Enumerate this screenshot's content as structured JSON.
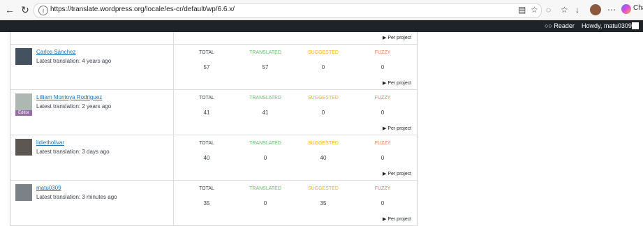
{
  "browser": {
    "url": "https://translate.wordpress.org/locale/es-cr/default/wp/6.6.x/",
    "copilot_label": "Cha",
    "icons": [
      "back-arrow-icon",
      "refresh-icon",
      "site-info-icon",
      "reader-view-icon",
      "star-icon",
      "extension-icon",
      "favorites-icon",
      "download-icon",
      "profile-icon",
      "more-icon",
      "copilot-icon"
    ]
  },
  "wp_bar": {
    "reader_label": "Reader",
    "howdy_label": "Howdy, matu0309"
  },
  "table": {
    "top_per_project": "Per project",
    "column_labels": {
      "total": "TOTAL",
      "translated": "TRANSLATED",
      "suggested": "SUGGESTED",
      "fuzzy": "FUZZY"
    },
    "per_project_label": "Per project",
    "rows": [
      {
        "name": "Carlos Sánchez",
        "latest": "Latest translation: 4 years ago",
        "total": "57",
        "translated": "57",
        "suggested": "0",
        "fuzzy": "0",
        "badge": ""
      },
      {
        "name": "Lilliam Montoya Rodriguez",
        "latest": "Latest translation: 2 years ago",
        "total": "41",
        "translated": "41",
        "suggested": "0",
        "fuzzy": "0",
        "badge": "Editor"
      },
      {
        "name": "lidietholivar",
        "latest": "Latest translation: 3 days ago",
        "total": "40",
        "translated": "0",
        "suggested": "40",
        "fuzzy": "0",
        "badge": ""
      },
      {
        "name": "matu0309",
        "latest": "Latest translation: 3 minutes ago",
        "total": "35",
        "translated": "0",
        "suggested": "35",
        "fuzzy": "0",
        "badge": ""
      }
    ]
  },
  "colors": {
    "total": "#3c434a",
    "translated": "#67c06b",
    "suggested": "#f2b324",
    "fuzzy": "#f07f57",
    "link": "#2271b1",
    "editor_badge": "#9b6bb0"
  }
}
